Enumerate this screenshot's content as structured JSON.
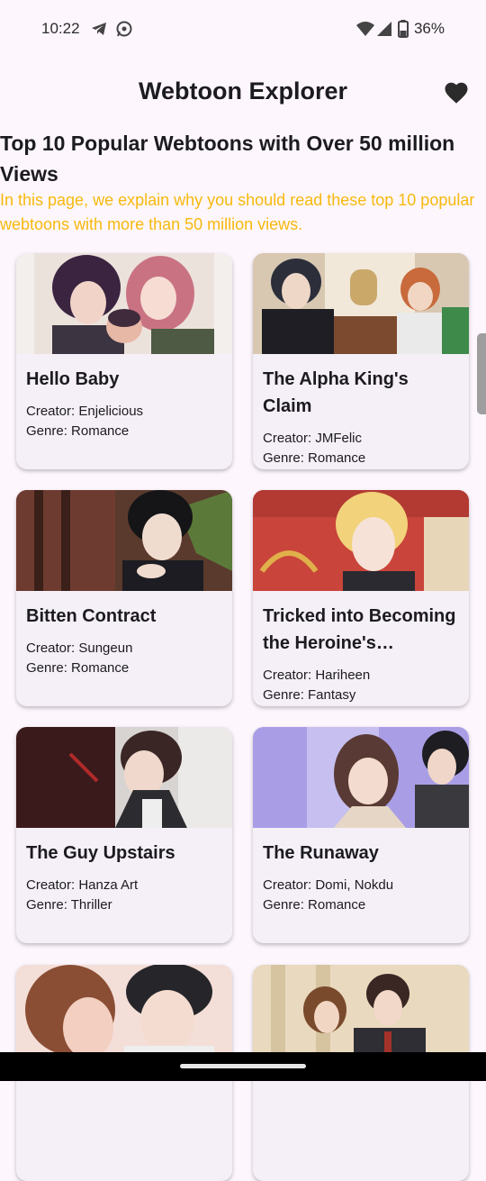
{
  "status": {
    "time": "10:22",
    "battery_percent": "36%",
    "icons": [
      "telegram-icon",
      "whatsapp-icon",
      "wifi-icon",
      "signal-icon",
      "battery-icon"
    ]
  },
  "appbar": {
    "title": "Webtoon Explorer",
    "action_icon": "heart-icon"
  },
  "intro": {
    "headline": "Top 10 Popular Webtoons with Over 50 million Views",
    "description": "In this page, we explain why you should read these top 10 popular webtoons with more than 50 million views."
  },
  "colors": {
    "accent_text": "#f7b90d",
    "card_bg": "#f5eff7",
    "page_bg": "#fdf6fd"
  },
  "webtoons": [
    {
      "title": "Hello Baby",
      "creator": "Creator: Enjelicious",
      "genre": "Genre: Romance"
    },
    {
      "title": "The Alpha King's Claim",
      "creator": "Creator: JMFelic",
      "genre": "Genre: Romance"
    },
    {
      "title": "Bitten Contract",
      "creator": "Creator: Sungeun",
      "genre": "Genre: Romance"
    },
    {
      "title": "Tricked into Becoming the Heroine's Stepmother",
      "creator": "Creator: Hariheen",
      "genre": "Genre: Fantasy"
    },
    {
      "title": "The Guy Upstairs",
      "creator": "Creator: Hanza Art",
      "genre": "Genre: Thriller"
    },
    {
      "title": "The Runaway",
      "creator": "Creator: Domi, Nokdu",
      "genre": "Genre: Romance"
    }
  ]
}
